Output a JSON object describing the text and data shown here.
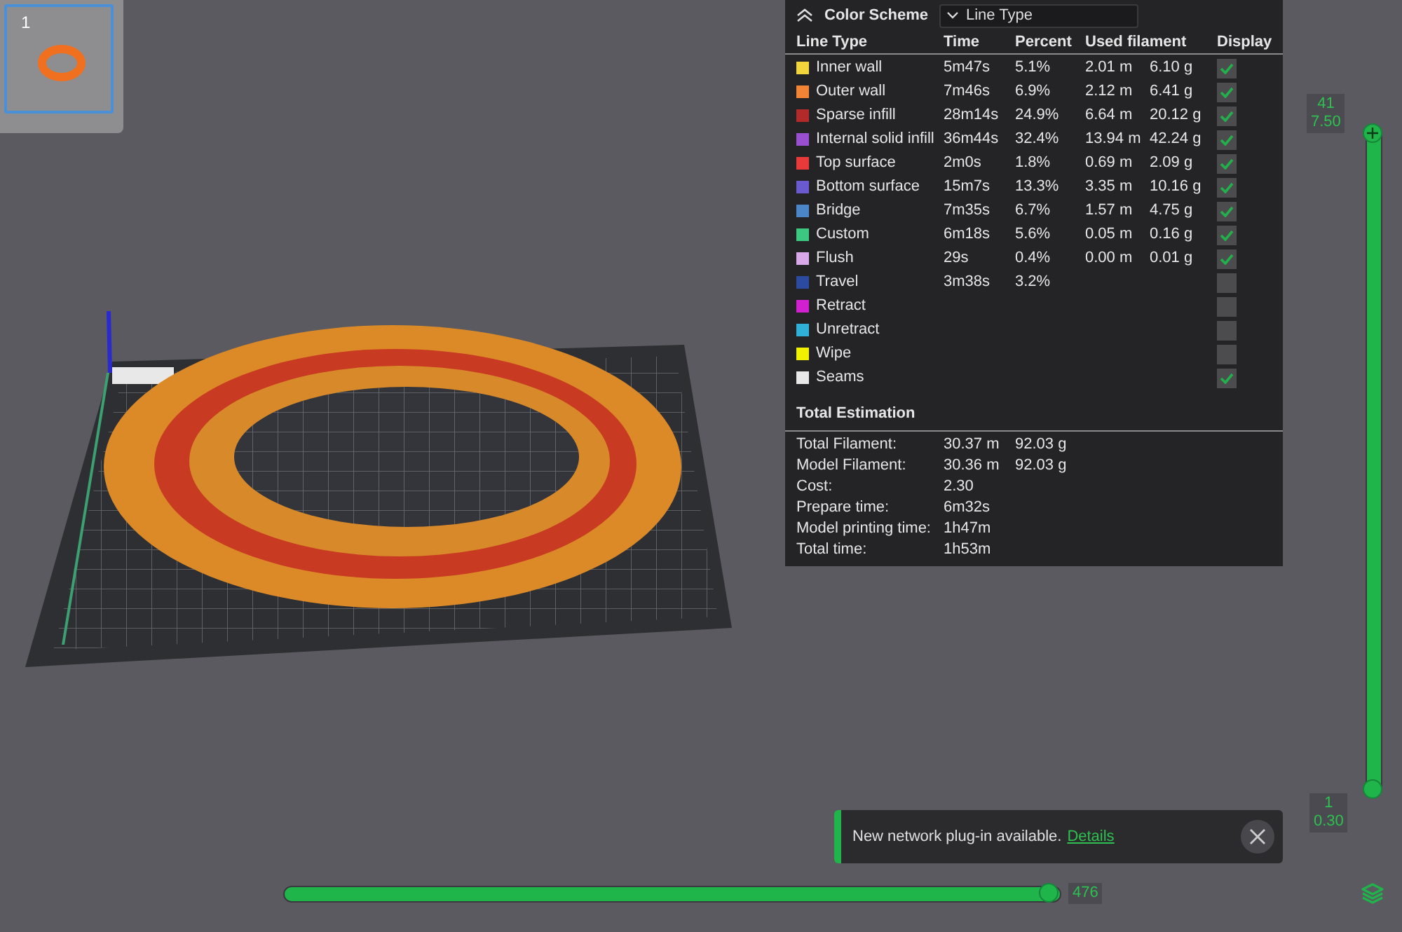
{
  "thumbnails": [
    {
      "label": "1",
      "selected": true
    }
  ],
  "legend": {
    "title": "Color Scheme",
    "dropdown": "Line Type",
    "columns": [
      "Line Type",
      "Time",
      "Percent",
      "Used filament",
      "Display"
    ],
    "rows": [
      {
        "name": "Inner wall",
        "color": "#f2d53c",
        "time": "5m47s",
        "percent": "5.1%",
        "length": "2.01 m",
        "weight": "6.10 g",
        "checked": true
      },
      {
        "name": "Outer wall",
        "color": "#f28435",
        "time": "7m46s",
        "percent": "6.9%",
        "length": "2.12 m",
        "weight": "6.41 g",
        "checked": true
      },
      {
        "name": "Sparse infill",
        "color": "#b32a2a",
        "time": "28m14s",
        "percent": "24.9%",
        "length": "6.64 m",
        "weight": "20.12 g",
        "checked": true
      },
      {
        "name": "Internal solid infill",
        "color": "#9a4fd0",
        "time": "36m44s",
        "percent": "32.4%",
        "length": "13.94 m",
        "weight": "42.24 g",
        "checked": true
      },
      {
        "name": "Top surface",
        "color": "#e83a3a",
        "time": "2m0s",
        "percent": "1.8%",
        "length": "0.69 m",
        "weight": "2.09 g",
        "checked": true
      },
      {
        "name": "Bottom surface",
        "color": "#6a5ad0",
        "time": "15m7s",
        "percent": "13.3%",
        "length": "3.35 m",
        "weight": "10.16 g",
        "checked": true
      },
      {
        "name": "Bridge",
        "color": "#4a86c8",
        "time": "7m35s",
        "percent": "6.7%",
        "length": "1.57 m",
        "weight": "4.75 g",
        "checked": true
      },
      {
        "name": "Custom",
        "color": "#3cc880",
        "time": "6m18s",
        "percent": "5.6%",
        "length": "0.05 m",
        "weight": "0.16 g",
        "checked": true
      },
      {
        "name": "Flush",
        "color": "#d8a8e8",
        "time": "29s",
        "percent": "0.4%",
        "length": "0.00 m",
        "weight": "0.01 g",
        "checked": true
      },
      {
        "name": "Travel",
        "color": "#2c4aa0",
        "time": "3m38s",
        "percent": "3.2%",
        "checked": false
      },
      {
        "name": "Retract",
        "color": "#d020d0",
        "checked": false
      },
      {
        "name": "Unretract",
        "color": "#30b0d8",
        "checked": false
      },
      {
        "name": "Wipe",
        "color": "#f0f000",
        "checked": false
      },
      {
        "name": "Seams",
        "color": "#e8e8e8",
        "checked": true
      }
    ],
    "totals_title": "Total Estimation",
    "totals": [
      {
        "label": "Total Filament:",
        "values": [
          "30.37 m",
          "92.03 g"
        ]
      },
      {
        "label": "Model Filament:",
        "values": [
          "30.36 m",
          "92.03 g"
        ]
      },
      {
        "label": "Cost:",
        "values": [
          "2.30"
        ]
      },
      {
        "label": "Prepare time:",
        "values": [
          "6m32s"
        ]
      },
      {
        "label": "Model printing time:",
        "values": [
          "1h47m"
        ]
      },
      {
        "label": "Total time:",
        "values": [
          "1h53m"
        ]
      }
    ]
  },
  "layer_slider": {
    "top_label": [
      "41",
      "7.50"
    ],
    "bottom_label": [
      "1",
      "0.30"
    ],
    "level": 1
  },
  "move_slider": {
    "value": "476",
    "level": 1
  },
  "notification": {
    "text": "New network plug-in available.",
    "link": "Details"
  }
}
